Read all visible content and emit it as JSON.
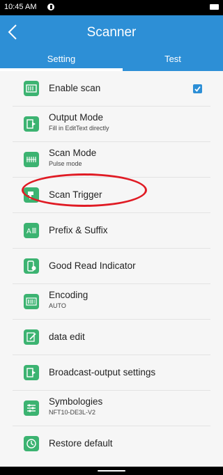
{
  "status_bar": {
    "time": "10:45 AM"
  },
  "app_bar": {
    "title": "Scanner"
  },
  "tabs": [
    {
      "label": "Setting",
      "selected": true
    },
    {
      "label": "Test",
      "selected": false
    }
  ],
  "settings": [
    {
      "label": "Enable scan",
      "subtitle": "",
      "icon": "scan-enable-icon",
      "checked": true
    },
    {
      "label": "Output Mode",
      "subtitle": "Fill in EditText directly",
      "icon": "output-icon"
    },
    {
      "label": "Scan Mode",
      "subtitle": "Pulse mode",
      "icon": "barcode-icon"
    },
    {
      "label": "Scan Trigger",
      "subtitle": "",
      "icon": "trigger-icon"
    },
    {
      "label": "Prefix & Suffix",
      "subtitle": "",
      "icon": "prefix-suffix-icon"
    },
    {
      "label": "Good Read Indicator",
      "subtitle": "",
      "icon": "good-read-icon"
    },
    {
      "label": "Encoding",
      "subtitle": "AUTO",
      "icon": "encoding-icon"
    },
    {
      "label": "data edit",
      "subtitle": "",
      "icon": "edit-icon"
    },
    {
      "label": "Broadcast-output settings",
      "subtitle": "",
      "icon": "broadcast-icon"
    },
    {
      "label": "Symbologies",
      "subtitle": "NFT10-DE3L-V2",
      "icon": "symbologies-icon"
    },
    {
      "label": "Restore default",
      "subtitle": "",
      "icon": "restore-icon"
    }
  ],
  "colors": {
    "primary": "#2d8fd6",
    "icon_green": "#3cb371",
    "highlight_red": "#e01b24"
  }
}
